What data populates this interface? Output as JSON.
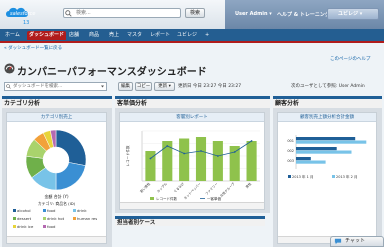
{
  "header": {
    "logo_text": "salesforce",
    "logo_badge": "13",
    "search_placeholder": "検索...",
    "search_button": "検索",
    "user_menu": "User Admin ▾",
    "help_link": "ヘルプ & トレーニング",
    "app_switcher": "ユビレジ ▾"
  },
  "tabs": [
    {
      "label": "ホーム"
    },
    {
      "label": "ダッシュボード",
      "active": true
    },
    {
      "label": "店舗"
    },
    {
      "label": "商品"
    },
    {
      "label": "売上"
    },
    {
      "label": "マスタ"
    },
    {
      "label": "レポート"
    },
    {
      "label": "ユビレジ"
    },
    {
      "label": "+"
    }
  ],
  "page": {
    "back_link": "« ダッシュボード一覧に戻る",
    "help_page": "このページのヘルプ",
    "title": "カンパニーパフォーマンスダッシュボード"
  },
  "controls": {
    "dashboard_search_placeholder": "ダッシュボードを検索...",
    "edit_button": "編集",
    "copy_button": "コピー",
    "update_button": "更新",
    "updated_text": "更新日 今日 23:27 今日 23:27",
    "viewer_text": "次のユーザとして参照: User Admin"
  },
  "columns": {
    "col1": {
      "heading": "カテゴリ分析",
      "panel_title": "カテゴリ別売上",
      "total_label": "金額 合計 (Y)",
      "legend_title": "カテゴリ: 商品名 (ID)"
    },
    "col2": {
      "heading": "客単価分析",
      "panel_title": "客層別レポート",
      "bottom_heading": "担当者別ケース"
    },
    "col3": {
      "heading": "顧客分析",
      "panel_title": "顧客別売上額分析合計金額"
    }
  },
  "chart_data": [
    {
      "type": "pie",
      "title": "カテゴリ別売上",
      "labels": [
        "alcohol",
        "food",
        "drink",
        "dessert",
        "drink hot",
        "human res",
        "drink ice",
        "food"
      ],
      "values": [
        28,
        22,
        15,
        12,
        10,
        6,
        4,
        3
      ],
      "colors": [
        "#1f5f97",
        "#3a8fd3",
        "#78c3e8",
        "#6fb04a",
        "#a9d36c",
        "#f2a13a",
        "#e7d43a",
        "#b56ab1"
      ]
    },
    {
      "type": "bar",
      "title": "客層別レポート",
      "categories": [
        "若い男性",
        "カップル",
        "ぐるなび",
        "ホットペッパー",
        "ファミリー",
        "女性グループ",
        "男性"
      ],
      "series": [
        {
          "name": "レコード件数",
          "type": "bar",
          "values": [
            60,
            80,
            85,
            88,
            80,
            70,
            80
          ],
          "color": "#8fc24c"
        },
        {
          "name": "一客単価",
          "type": "line",
          "values": [
            45,
            70,
            55,
            60,
            50,
            58,
            80
          ],
          "color": "#1f5f97"
        }
      ],
      "ylabel": "レコード件数",
      "ylim": [
        0,
        100
      ]
    },
    {
      "type": "bar",
      "title": "顧客別売上額分析合計金額",
      "categories": [
        "001",
        "002",
        "003"
      ],
      "series": [
        {
          "name": "2013 年 1 月",
          "values": [
            80,
            55,
            20
          ],
          "color": "#1f5f97"
        },
        {
          "name": "2013 年 2 月",
          "values": [
            95,
            75,
            40
          ],
          "color": "#78c3e8"
        }
      ],
      "xlim": [
        0,
        100
      ]
    }
  ],
  "chat": {
    "label": "チャット"
  }
}
